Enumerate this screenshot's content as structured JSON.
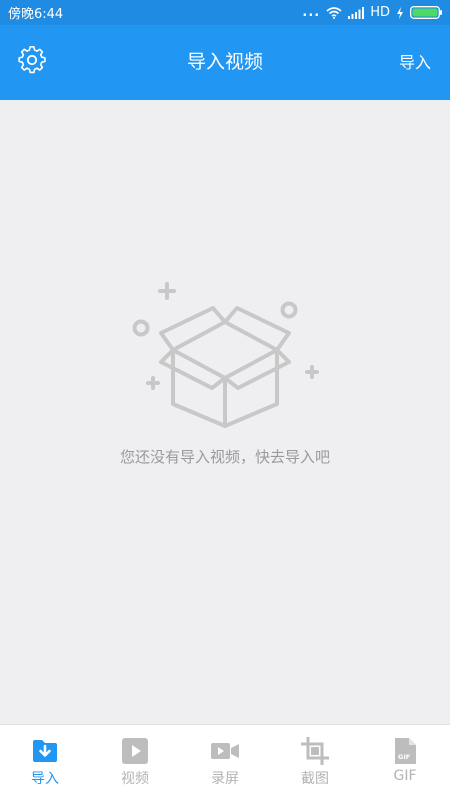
{
  "statusbar": {
    "time": "傍晚6:44",
    "dots": "...",
    "network": "HD"
  },
  "appbar": {
    "title": "导入视频",
    "import_label": "导入",
    "settings_icon": "gear-icon"
  },
  "empty_state": {
    "message": "您还没有导入视频，快去导入吧",
    "illustration_icon": "empty-box-icon"
  },
  "tabs": [
    {
      "label": "导入",
      "icon": "import-folder-icon",
      "active": true
    },
    {
      "label": "视频",
      "icon": "play-icon",
      "active": false
    },
    {
      "label": "录屏",
      "icon": "camera-icon",
      "active": false
    },
    {
      "label": "截图",
      "icon": "crop-icon",
      "active": false
    },
    {
      "label": "GIF",
      "icon": "gif-file-icon",
      "active": false
    }
  ],
  "colors": {
    "statusbar": "#1f8be3",
    "appbar": "#2196f3",
    "background": "#efeef1",
    "accent": "#2196f3",
    "inactive": "#b3b3b3",
    "battery": "#4cd964"
  }
}
